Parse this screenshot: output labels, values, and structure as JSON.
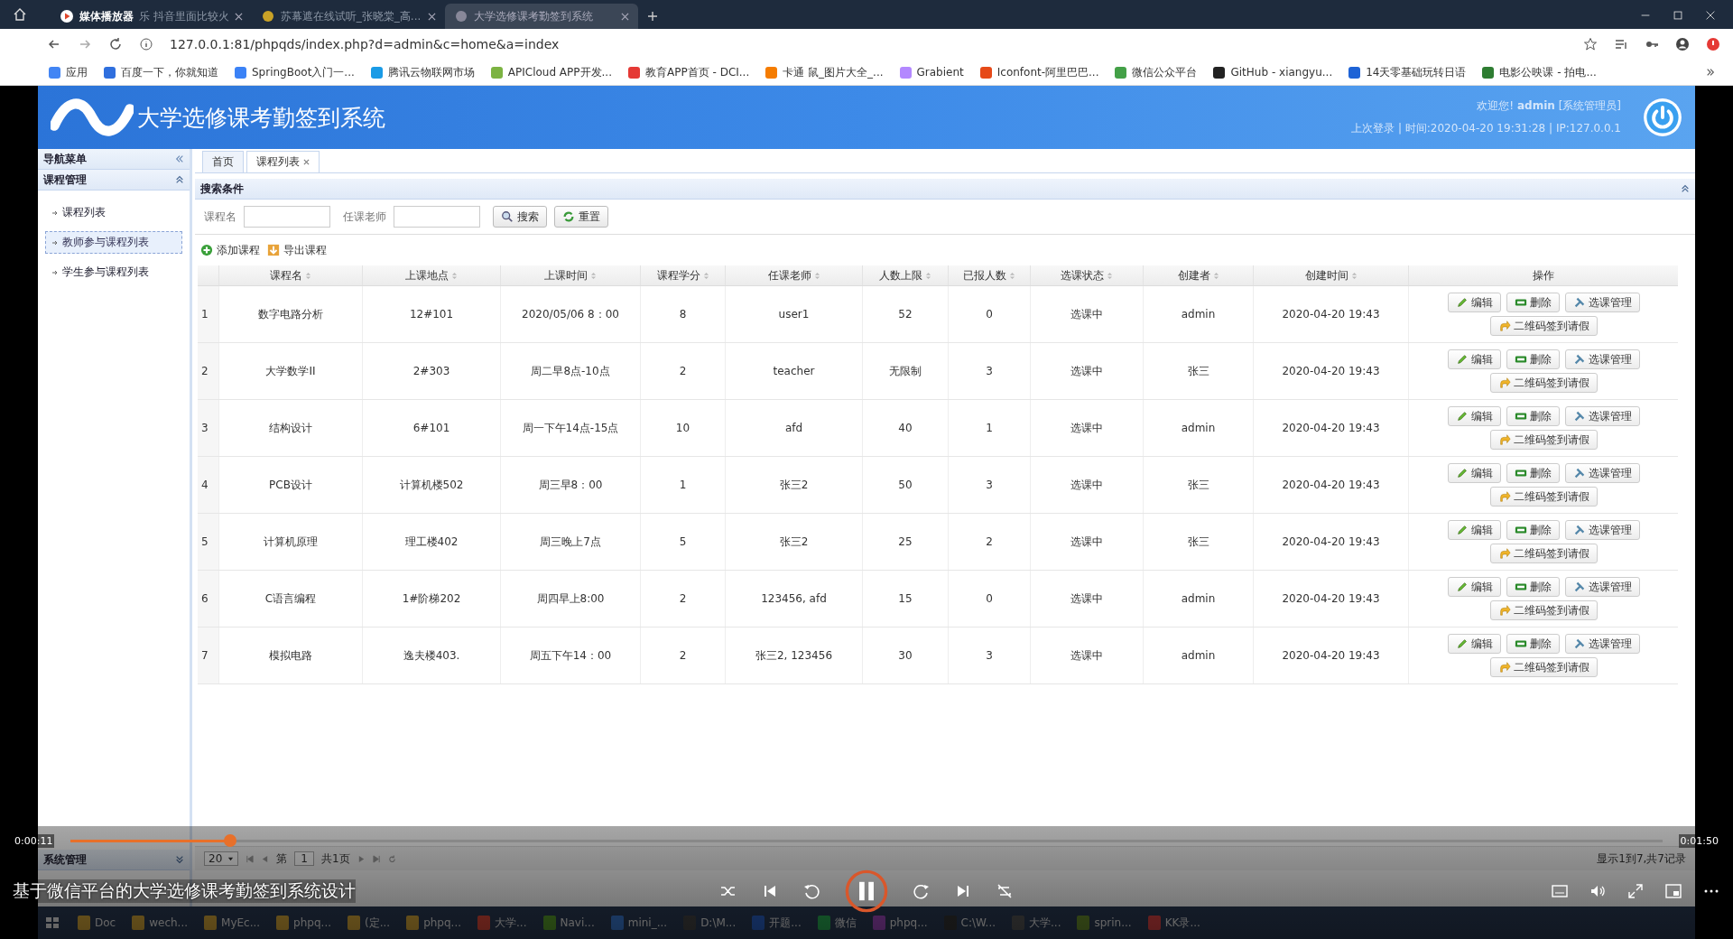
{
  "player": {
    "title": "媒体播放器",
    "video_title": "基于微信平台的大学选修课考勤签到系统设计",
    "elapsed": "0:00:11",
    "duration": "0:01:50",
    "level": 0.1,
    "playing": true
  },
  "browser": {
    "tabs": [
      {
        "label": "乐 抖音里面比较火",
        "selected": false
      },
      {
        "label": "苏幕遮在线试听_张晓棠_高...",
        "selected": false
      },
      {
        "label": "大学选修课考勤签到系统",
        "selected": true
      }
    ],
    "url": "127.0.0.1:81/phpqds/index.php?d=admin&c=home&a=index",
    "bookmarks": [
      "应用",
      "百度一下，你就知道",
      "SpringBoot入门一...",
      "腾讯云物联网市场",
      "APICloud APP开发...",
      "教育APP首页 - DCI...",
      "卡通 鼠_图片大全_...",
      "Grabient",
      "Iconfont-阿里巴巴...",
      "微信公众平台",
      "GitHub - xiangyu...",
      "14天零基础玩转日语",
      "电影公映课 - 拍电..."
    ]
  },
  "app": {
    "title": "大学选修课考勤签到系统",
    "welcome": "欢迎您! **admin** [系统管理员]",
    "last_login": "上次登录 | 时间:2020-04-20 19:31:28 | IP:127.0.0.1"
  },
  "sidebar": {
    "title": "导航菜单",
    "groups": [
      {
        "label": "课程管理",
        "expanded": true,
        "items": [
          {
            "label": "课程列表",
            "selected": false
          },
          {
            "label": "教师参与课程列表",
            "selected": true
          },
          {
            "label": "学生参与课程列表",
            "selected": false
          }
        ]
      },
      {
        "label": "系统管理",
        "expanded": false
      }
    ]
  },
  "tabs": [
    {
      "label": "首页",
      "selected": false,
      "closable": false
    },
    {
      "label": "课程列表",
      "selected": true,
      "closable": true
    }
  ],
  "search": {
    "title": "搜索条件",
    "fields": [
      {
        "label": "课程名"
      },
      {
        "label": "任课老师"
      }
    ],
    "buttons": [
      {
        "kind": "search",
        "label": "搜索"
      },
      {
        "kind": "reset",
        "label": "重置"
      }
    ]
  },
  "toolbar": [
    {
      "kind": "add",
      "label": "添加课程"
    },
    {
      "kind": "export",
      "label": "导出课程"
    }
  ],
  "table": {
    "columns": [
      {
        "label": "课程名",
        "sortable": true
      },
      {
        "label": "上课地点",
        "sortable": true
      },
      {
        "label": "上课时间",
        "sortable": true
      },
      {
        "label": "课程学分",
        "sortable": true
      },
      {
        "label": "任课老师",
        "sortable": true
      },
      {
        "label": "人数上限",
        "sortable": true
      },
      {
        "label": "已报人数",
        "sortable": true
      },
      {
        "label": "选课状态",
        "sortable": true
      },
      {
        "label": "创建者",
        "sortable": true
      },
      {
        "label": "创建时间",
        "sortable": true
      },
      {
        "label": "操作",
        "sortable": false
      }
    ],
    "rows": [
      {
        "num": "1",
        "cells": [
          "数字电路分析",
          "12#101",
          "2020/05/06 8：00",
          "8",
          "user1",
          "52",
          "0",
          "选课中",
          "admin",
          "2020-04-20 19:43"
        ],
        "actions": [
          "编辑",
          "删除",
          "选课管理",
          "二维码签到请假"
        ]
      },
      {
        "num": "2",
        "cells": [
          "大学数学II",
          "2#303",
          "周二早8点-10点",
          "2",
          "teacher",
          "无限制",
          "3",
          "选课中",
          "张三",
          "2020-04-20 19:43"
        ],
        "actions": [
          "编辑",
          "删除",
          "选课管理",
          "二维码签到请假"
        ]
      },
      {
        "num": "3",
        "cells": [
          "结构设计",
          "6#101",
          "周一下午14点-15点",
          "10",
          "afd",
          "40",
          "1",
          "选课中",
          "admin",
          "2020-04-20 19:43"
        ],
        "actions": [
          "编辑",
          "删除",
          "选课管理",
          "二维码签到请假"
        ]
      },
      {
        "num": "4",
        "cells": [
          "PCB设计",
          "计算机楼502",
          "周三早8：00",
          "1",
          "张三2",
          "50",
          "3",
          "选课中",
          "张三",
          "2020-04-20 19:43"
        ],
        "actions": [
          "编辑",
          "删除",
          "选课管理",
          "二维码签到请假"
        ]
      },
      {
        "num": "5",
        "cells": [
          "计算机原理",
          "理工楼402",
          "周三晚上7点",
          "5",
          "张三2",
          "25",
          "2",
          "选课中",
          "张三",
          "2020-04-20 19:43"
        ],
        "actions": [
          "编辑",
          "删除",
          "选课管理",
          "二维码签到请假"
        ]
      },
      {
        "num": "6",
        "cells": [
          "C语言编程",
          "1#阶梯202",
          "周四早上8:00",
          "2",
          "123456, afd",
          "15",
          "0",
          "选课中",
          "admin",
          "2020-04-20 19:43"
        ],
        "actions": [
          "编辑",
          "删除",
          "选课管理",
          "二维码签到请假"
        ]
      },
      {
        "num": "7",
        "cells": [
          "模拟电路",
          "逸夫楼403.",
          "周五下午14：00",
          "2",
          "张三2, 123456",
          "30",
          "3",
          "选课中",
          "admin",
          "2020-04-20 19:43"
        ],
        "actions": [
          "编辑",
          "删除",
          "选课管理",
          "二维码签到请假"
        ]
      }
    ]
  },
  "pager": {
    "page_size": "20",
    "page_prefix": "第",
    "page": "1",
    "page_total": "共1页",
    "summary": "显示1到7,共7记录"
  },
  "taskbar": [
    "Doc",
    "wech...",
    "MyEc...",
    "phpq...",
    "(定...",
    "phpq...",
    "大学...",
    "Navi...",
    "mini_...",
    "D:\\M...",
    "开题...",
    "微信",
    "phpq...",
    "C:\\W...",
    "大学...",
    "sprin...",
    "KK录..."
  ]
}
